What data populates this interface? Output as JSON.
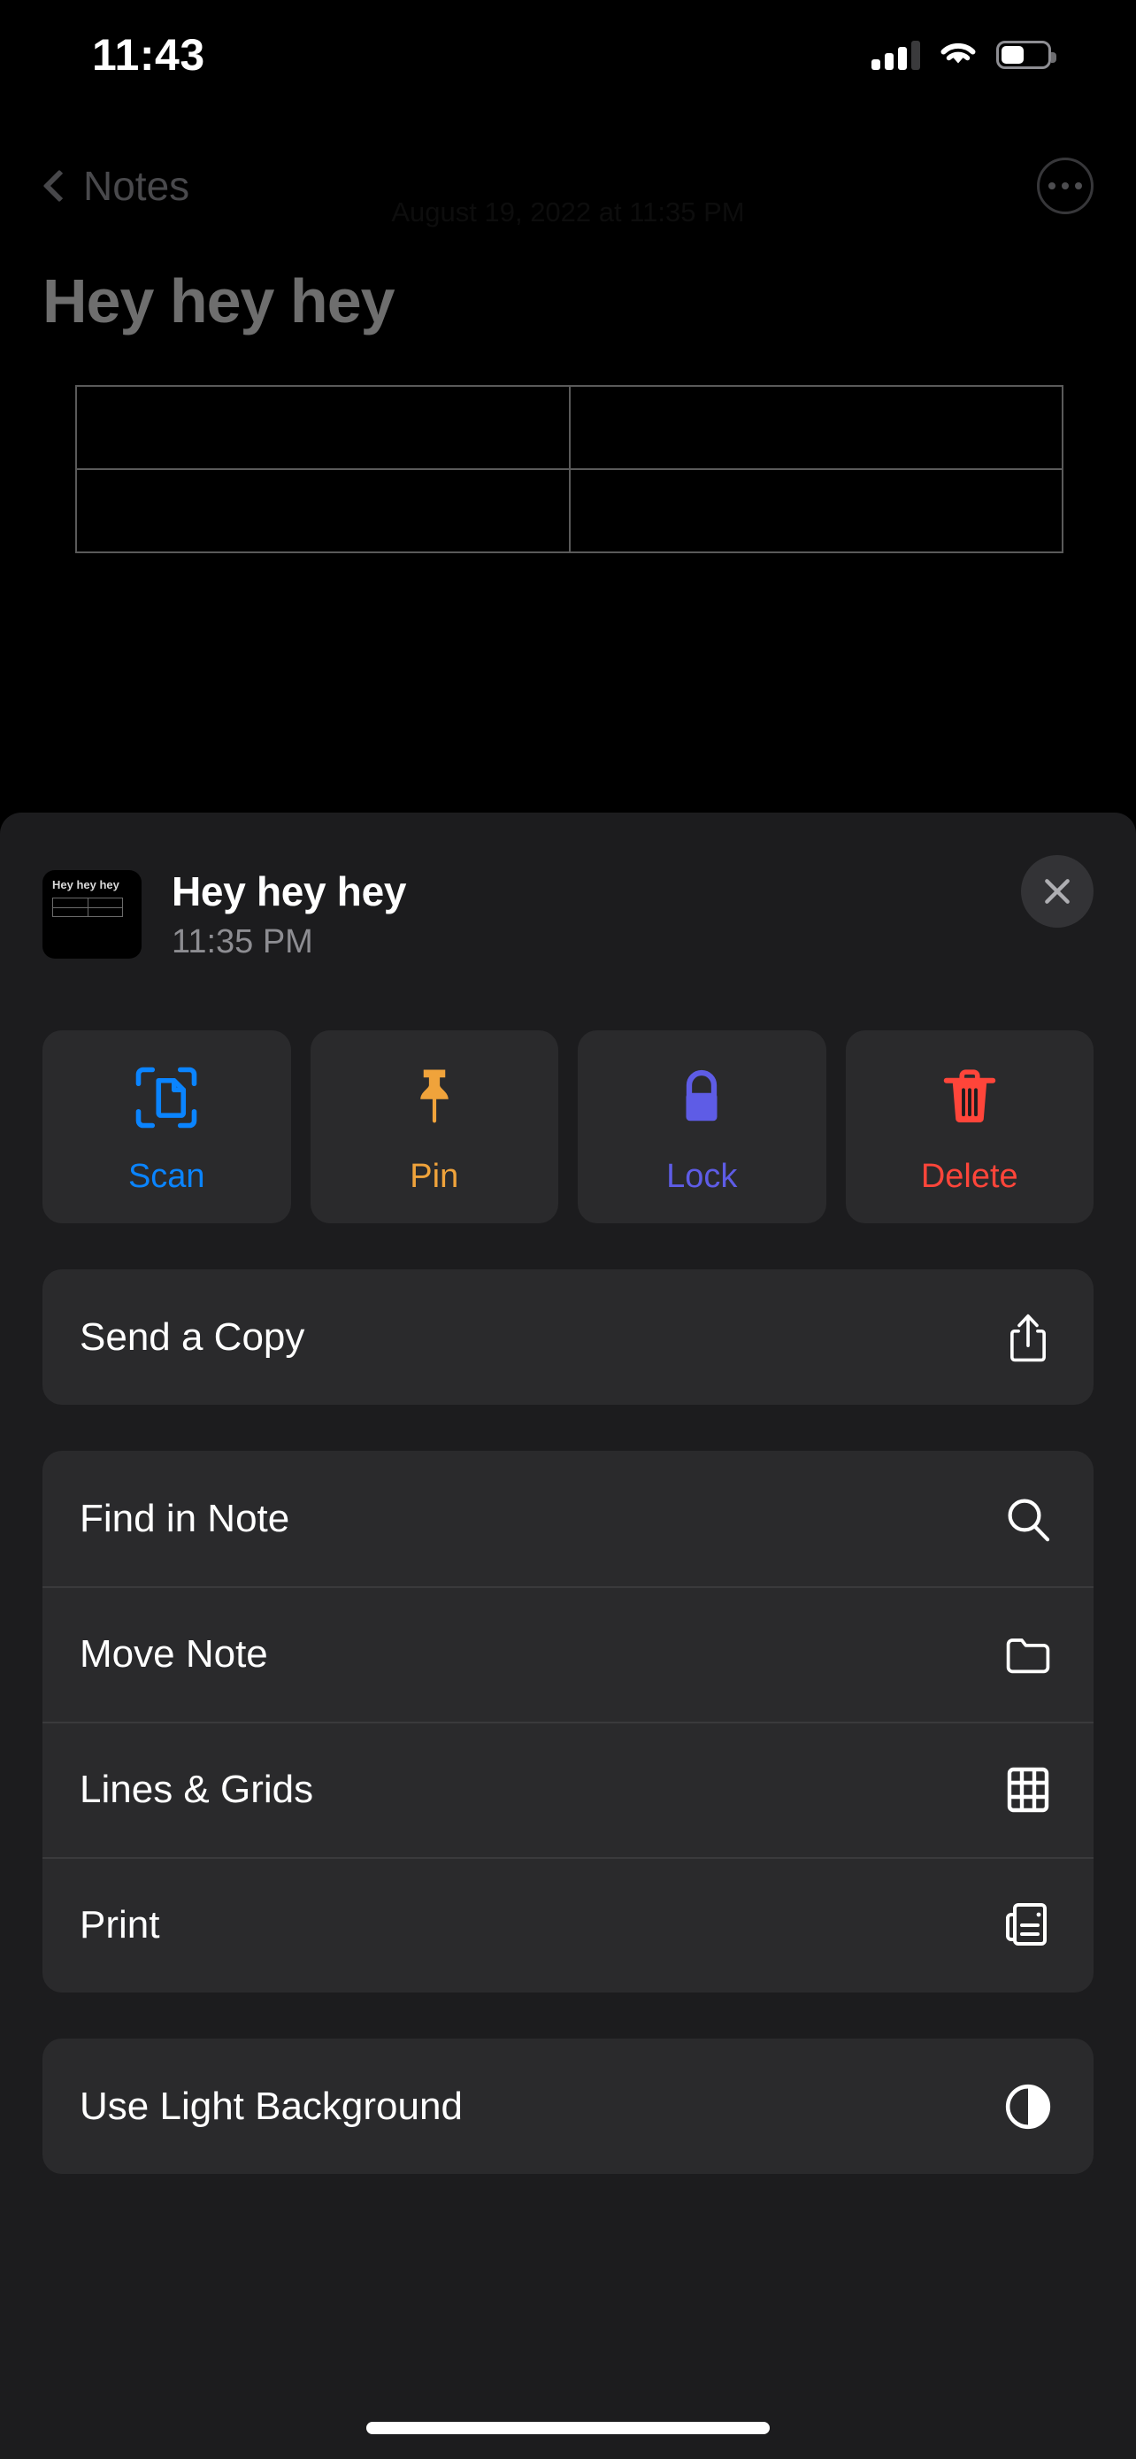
{
  "status_bar": {
    "time": "11:43",
    "cellular_icon": "cellular-signal-icon",
    "wifi_icon": "wifi-icon",
    "battery_icon": "battery-icon",
    "battery_level_percent": 50,
    "cellular_bars_filled": 3,
    "cellular_bars_total": 4
  },
  "nav_bar": {
    "back_label": "Notes",
    "back_icon": "chevron-left-icon",
    "more_icon": "ellipsis-circle-icon"
  },
  "note": {
    "date": "August 19, 2022 at 11:35 PM",
    "title": "Hey hey hey",
    "table": {
      "rows": 2,
      "columns": 2,
      "cells": [
        [
          "",
          ""
        ],
        [
          "",
          ""
        ]
      ]
    }
  },
  "action_sheet": {
    "thumbnail": {
      "title": "Hey hey hey",
      "name": "note-thumbnail"
    },
    "title": "Hey hey hey",
    "subtitle": "11:35 PM",
    "close_icon": "close-icon",
    "quick_actions": [
      {
        "label": "Scan",
        "icon": "scan-document-icon",
        "color": "#0A84FF"
      },
      {
        "label": "Pin",
        "icon": "pin-icon",
        "color": "#F0A33B"
      },
      {
        "label": "Lock",
        "icon": "lock-icon",
        "color": "#5E5CE6"
      },
      {
        "label": "Delete",
        "icon": "trash-icon",
        "color": "#FF453A"
      }
    ],
    "groups": [
      {
        "name": "share-group",
        "rows": [
          {
            "label": "Send a Copy",
            "icon": "share-icon"
          }
        ]
      },
      {
        "name": "note-tools-group",
        "rows": [
          {
            "label": "Find in Note",
            "icon": "search-icon"
          },
          {
            "label": "Move Note",
            "icon": "folder-icon"
          },
          {
            "label": "Lines & Grids",
            "icon": "grid-icon"
          },
          {
            "label": "Print",
            "icon": "printer-icon"
          }
        ]
      },
      {
        "name": "appearance-group",
        "rows": [
          {
            "label": "Use Light Background",
            "icon": "contrast-circle-icon"
          }
        ]
      }
    ]
  },
  "home_indicator": "home-indicator",
  "colors": {
    "sheet_background": "#1C1C1E",
    "row_background": "#2A2A2C",
    "separator": "#3A3A3C",
    "page_background": "#000000"
  }
}
